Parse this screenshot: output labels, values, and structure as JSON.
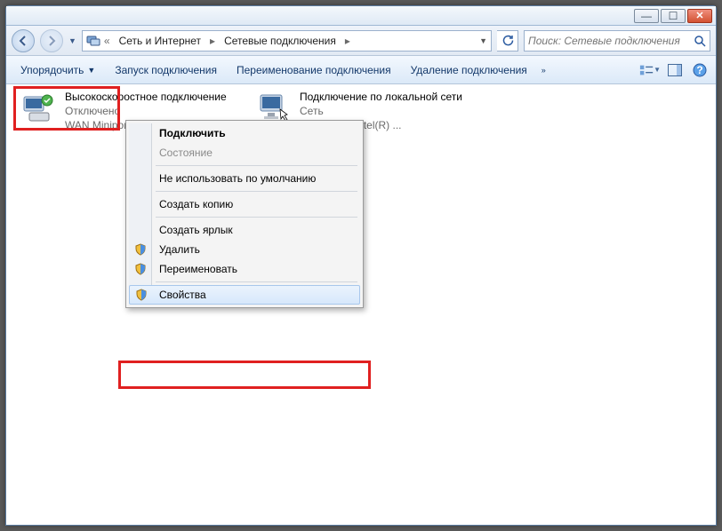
{
  "window": {
    "min_tip": "Свернуть",
    "max_tip": "Развернуть",
    "close_tip": "Закрыть"
  },
  "breadcrumb": {
    "seg1": "Сеть и Интернет",
    "seg2": "Сетевые подключения"
  },
  "search": {
    "placeholder": "Поиск: Сетевые подключения"
  },
  "toolbar": {
    "organize": "Упорядочить",
    "start_conn": "Запуск подключения",
    "rename_conn": "Переименование подключения",
    "delete_conn": "Удаление подключения"
  },
  "connections": [
    {
      "name": "Высокоскоростное подключение",
      "status": "Отключено",
      "device": "WAN Miniport"
    },
    {
      "name": "Подключение по локальной сети",
      "status": "Сеть",
      "device_suffix": "чего стола Intel(R) ..."
    }
  ],
  "context_menu": {
    "connect": "Подключить",
    "status": "Состояние",
    "not_default": "Не использовать по умолчанию",
    "copy": "Создать копию",
    "shortcut": "Создать ярлык",
    "delete": "Удалить",
    "rename": "Переименовать",
    "properties": "Свойства"
  }
}
